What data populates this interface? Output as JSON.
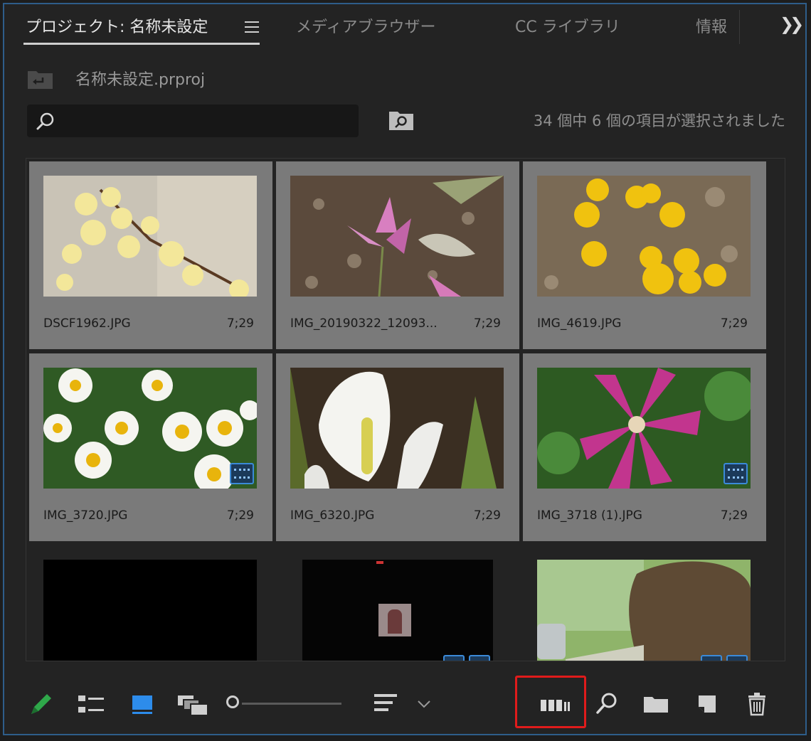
{
  "tabs": [
    {
      "label": "プロジェクト: 名称未設定"
    },
    {
      "label": "メディアブラウザー"
    },
    {
      "label": "CC ライブラリ"
    },
    {
      "label": "情報"
    }
  ],
  "project": {
    "file_name": "名称未設定.prproj"
  },
  "search": {
    "placeholder": "",
    "value": ""
  },
  "selection_status": "34 個中 6 個の項目が選択されました",
  "items": [
    {
      "name": "DSCF1962.JPG",
      "duration": "7;29",
      "selected": true,
      "badge": false
    },
    {
      "name": "IMG_20190322_12093...",
      "duration": "7;29",
      "selected": true,
      "badge": false
    },
    {
      "name": "IMG_4619.JPG",
      "duration": "7;29",
      "selected": true,
      "badge": false
    },
    {
      "name": "IMG_3720.JPG",
      "duration": "7;29",
      "selected": true,
      "badge": true
    },
    {
      "name": "IMG_6320.JPG",
      "duration": "7;29",
      "selected": true,
      "badge": false
    },
    {
      "name": "IMG_3718 (1).JPG",
      "duration": "7;29",
      "selected": true,
      "badge": true
    },
    {
      "name": "",
      "duration": "",
      "selected": false,
      "badge": false
    },
    {
      "name": "",
      "duration": "",
      "selected": false,
      "badge": true
    },
    {
      "name": "",
      "duration": "",
      "selected": false,
      "badge": true
    }
  ],
  "toolbar": {
    "icons": [
      "pencil-icon",
      "list-view-icon",
      "icon-view-icon",
      "freeform-view-icon",
      "zoom-slider",
      "sort-icon",
      "chevron-down-icon",
      "automate-to-sequence-icon",
      "find-icon",
      "new-bin-icon",
      "new-item-icon",
      "trash-icon"
    ],
    "accent_color": "#2d8ceb",
    "highlight_color": "#e01b1b"
  }
}
